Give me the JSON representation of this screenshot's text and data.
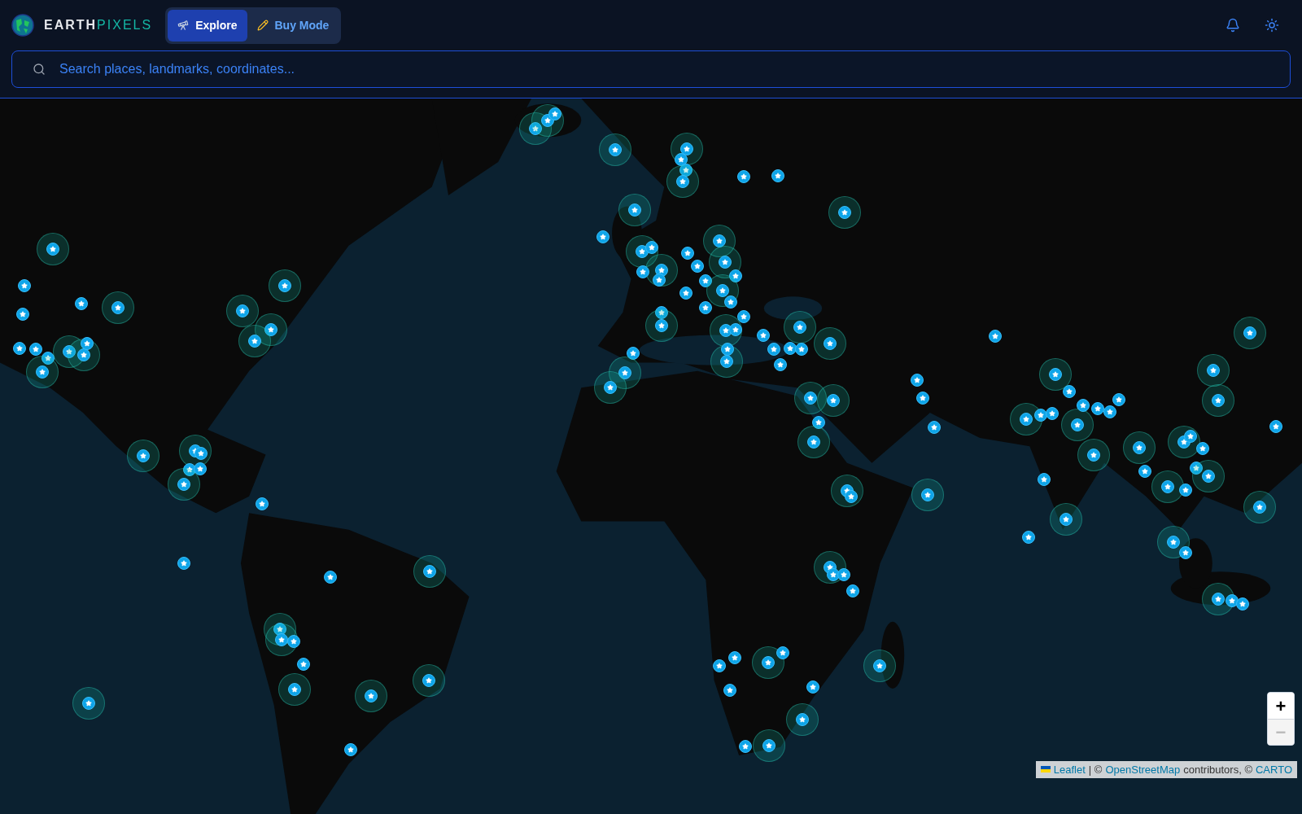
{
  "brand": {
    "first": "EARTH",
    "second": "PIXELS"
  },
  "modes": [
    {
      "label": "Explore",
      "kind": "explore",
      "selected": true
    },
    {
      "label": "Buy Mode",
      "kind": "buy",
      "selected": false
    }
  ],
  "search": {
    "placeholder": "Search places, landmarks, coordinates..."
  },
  "map": {
    "kind": "picture",
    "zoom_controls": [
      {
        "label": "+",
        "disabled": false
      },
      {
        "label": "−",
        "disabled": true
      }
    ],
    "attribution": {
      "links": [
        "Leaflet",
        "OpenStreetMap",
        "CARTO"
      ],
      "texts": [
        "|",
        "©",
        "contributors, ©"
      ]
    }
  }
}
